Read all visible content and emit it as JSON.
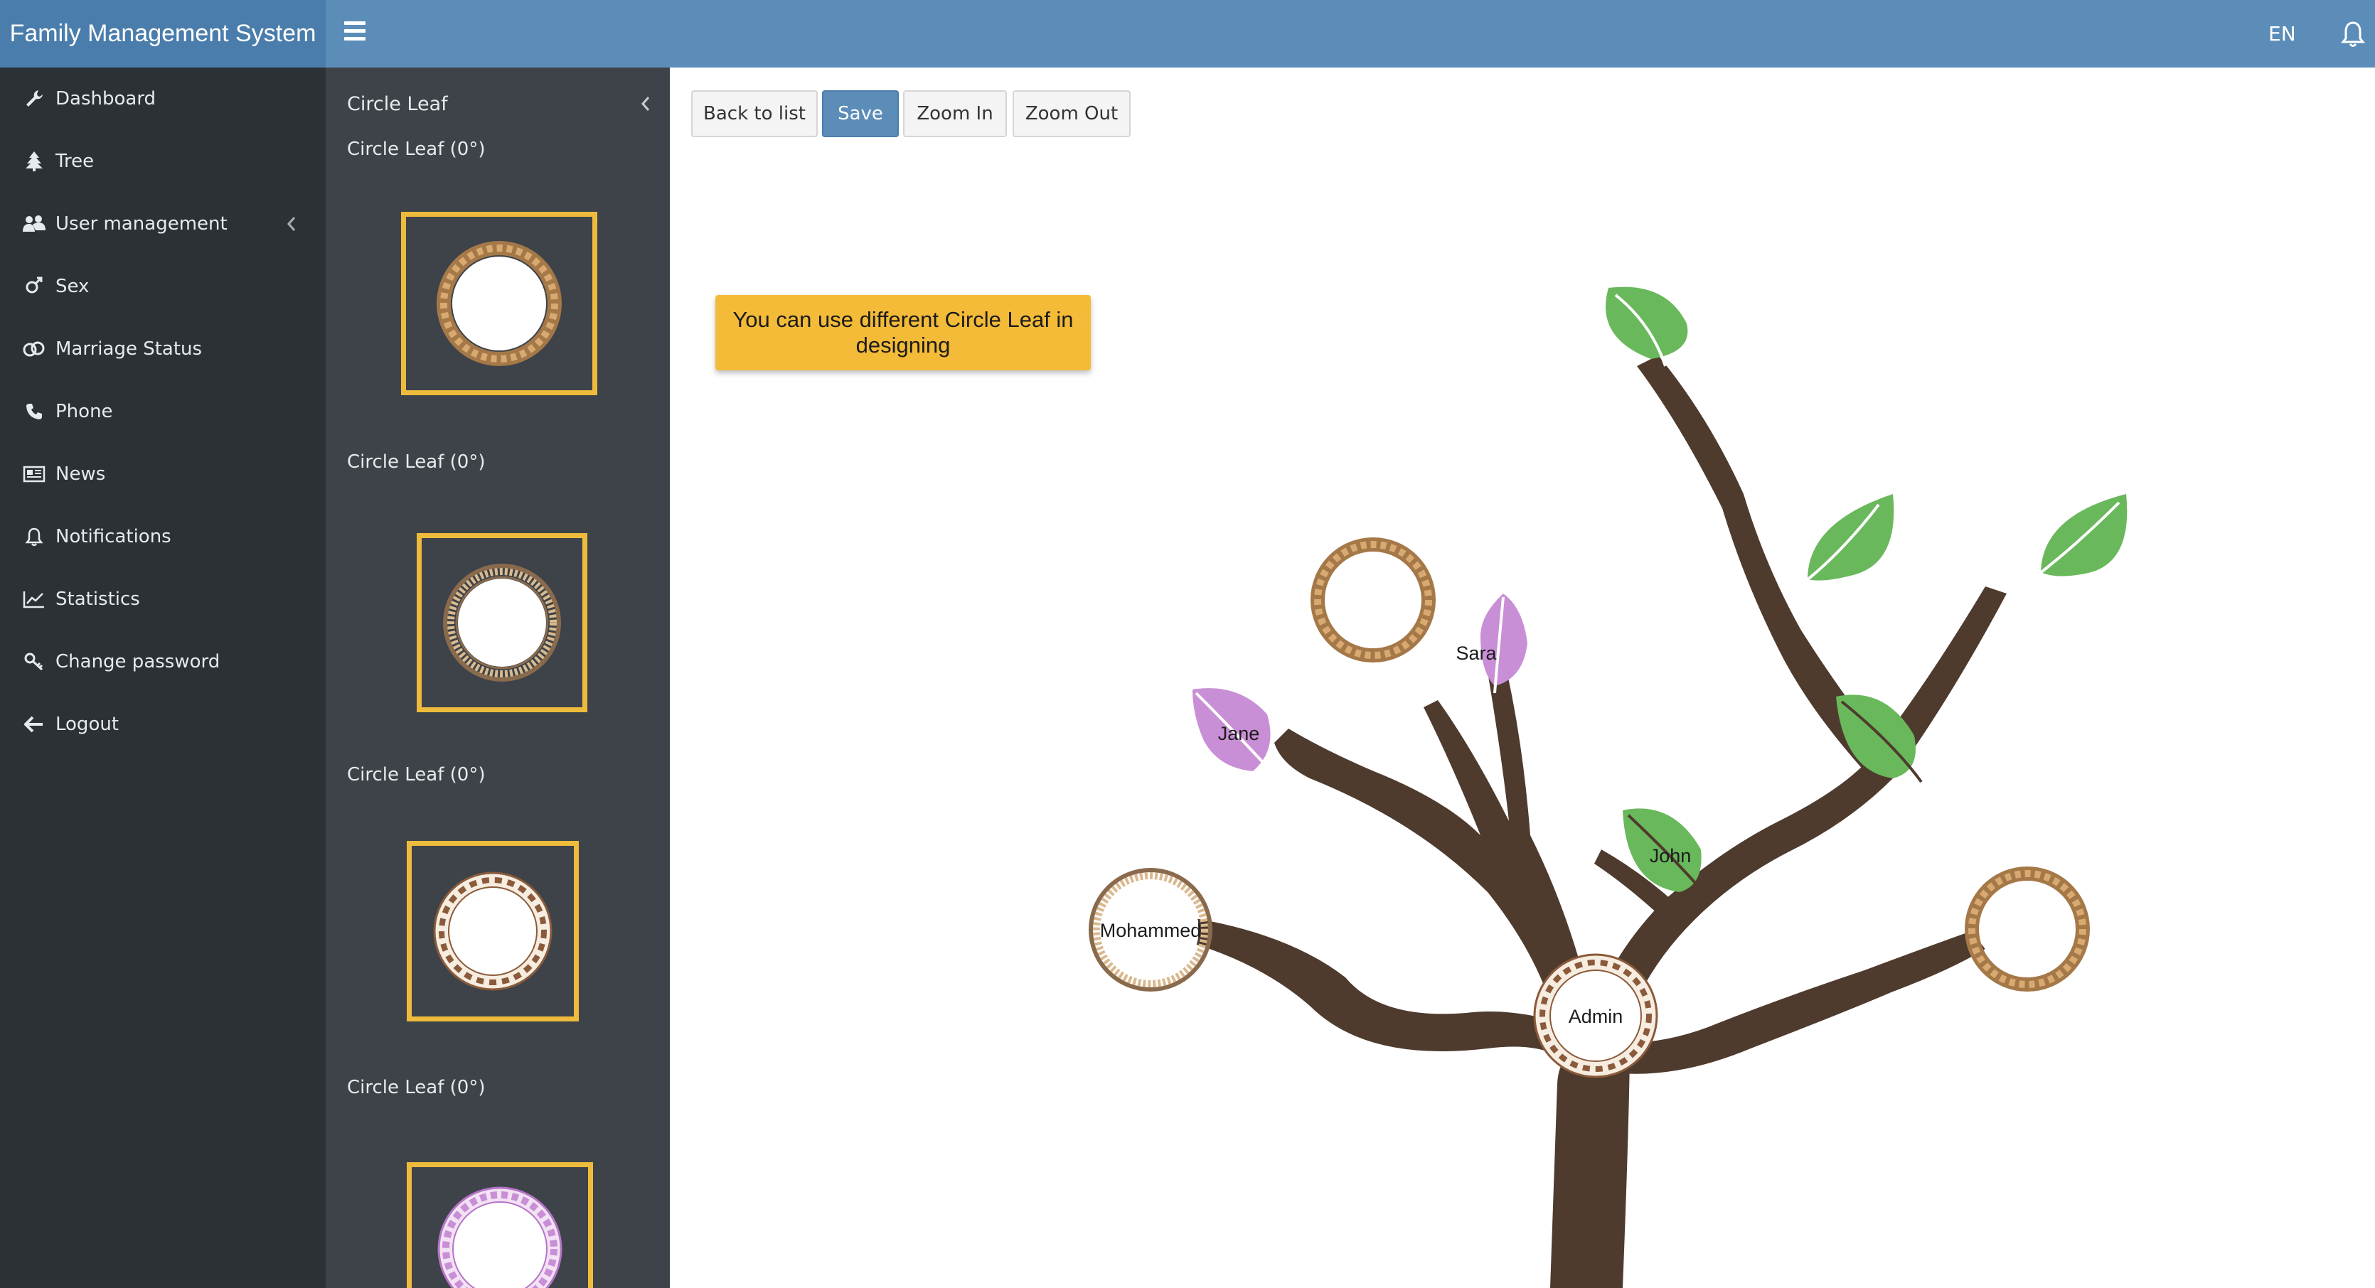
{
  "header": {
    "brand": "Family Management System",
    "language": "EN"
  },
  "sidebar": {
    "items": [
      {
        "label": "Dashboard",
        "icon": "wrench-icon"
      },
      {
        "label": "Tree",
        "icon": "tree-icon"
      },
      {
        "label": "User management",
        "icon": "users-icon"
      },
      {
        "label": "Sex",
        "icon": "gender-icon"
      },
      {
        "label": "Marriage Status",
        "icon": "rings-icon"
      },
      {
        "label": "Phone",
        "icon": "phone-icon"
      },
      {
        "label": "News",
        "icon": "newspaper-icon"
      },
      {
        "label": "Notifications",
        "icon": "bell-icon"
      },
      {
        "label": "Statistics",
        "icon": "line-chart-icon"
      },
      {
        "label": "Change password",
        "icon": "key-icon"
      },
      {
        "label": "Logout",
        "icon": "arrow-left-icon"
      }
    ]
  },
  "leaf_panel": {
    "title": "Circle Leaf",
    "items": [
      {
        "label": "Circle Leaf (0°)",
        "style": "rope"
      },
      {
        "label": "Circle Leaf (0°)",
        "style": "beaded"
      },
      {
        "label": "Circle Leaf (0°)",
        "style": "ornate"
      },
      {
        "label": "Circle Leaf (0°)",
        "style": "purple-ornate"
      }
    ]
  },
  "toolbar": {
    "back_label": "Back to list",
    "save_label": "Save",
    "zoom_in_label": "Zoom In",
    "zoom_out_label": "Zoom Out"
  },
  "callout": {
    "text": "You can use different Circle Leaf in designing"
  },
  "tree": {
    "nodes": [
      {
        "label": "Admin",
        "kind": "circle-ornate"
      },
      {
        "label": "Mohammed",
        "kind": "circle-beaded"
      },
      {
        "label": "Jane",
        "kind": "leaf-purple"
      },
      {
        "label": "Sara",
        "kind": "leaf-purple"
      },
      {
        "label": "John",
        "kind": "leaf-green"
      },
      {
        "label": "",
        "kind": "circle-rope"
      },
      {
        "label": "",
        "kind": "circle-rope"
      }
    ]
  },
  "colors": {
    "header": "#5b8db8",
    "brand_bg": "#4a7dab",
    "sidebar": "#2c3136",
    "panel": "#3d4348",
    "accent": "#efbb3c",
    "callout": "#f4bb38",
    "branch": "#4e3b2e",
    "leaf_green": "#6ab85c",
    "leaf_purple": "#c98fd6"
  }
}
